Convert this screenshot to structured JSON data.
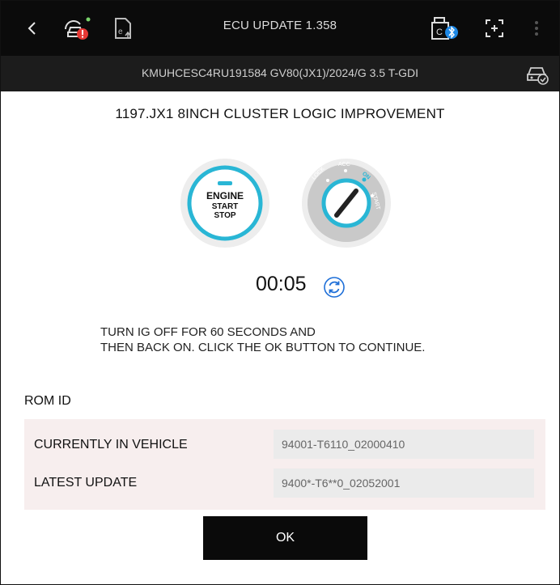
{
  "header": {
    "title": "ECU UPDATE 1.358",
    "icons": [
      "back-icon",
      "vehicle-alert-icon",
      "file-upload-icon",
      "vci-bluetooth-icon",
      "screenshot-icon",
      "more-icon"
    ]
  },
  "vehicle": {
    "info": "KMUHCESC4RU191584  GV80(JX1)/2024/G 3.5 T-GDI"
  },
  "update": {
    "title": "1197.JX1 8INCH CLUSTER LOGIC IMPROVEMENT"
  },
  "engine_button": {
    "line1": "ENGINE",
    "line2": "START",
    "line3": "STOP"
  },
  "ignition": {
    "lock": "LOCK",
    "acc": "ACC",
    "on": "ON",
    "start": "START"
  },
  "timer": {
    "value": "00:05"
  },
  "instruction": {
    "line1": "TURN IG OFF FOR 60 SECONDS AND",
    "line2": "THEN BACK ON. CLICK THE OK BUTTON TO CONTINUE."
  },
  "rom": {
    "heading": "ROM ID",
    "rows": [
      {
        "label": "CURRENTLY IN VEHICLE",
        "value": "94001-T6110_02000410"
      },
      {
        "label": "LATEST UPDATE",
        "value": "9400*-T6**0_02052001"
      }
    ]
  },
  "actions": {
    "ok_label": "OK"
  },
  "colors": {
    "accent": "#1fb6d3",
    "alert": "#e53935",
    "status_green": "#7ad36b",
    "bluetooth": "#1e88e5"
  }
}
